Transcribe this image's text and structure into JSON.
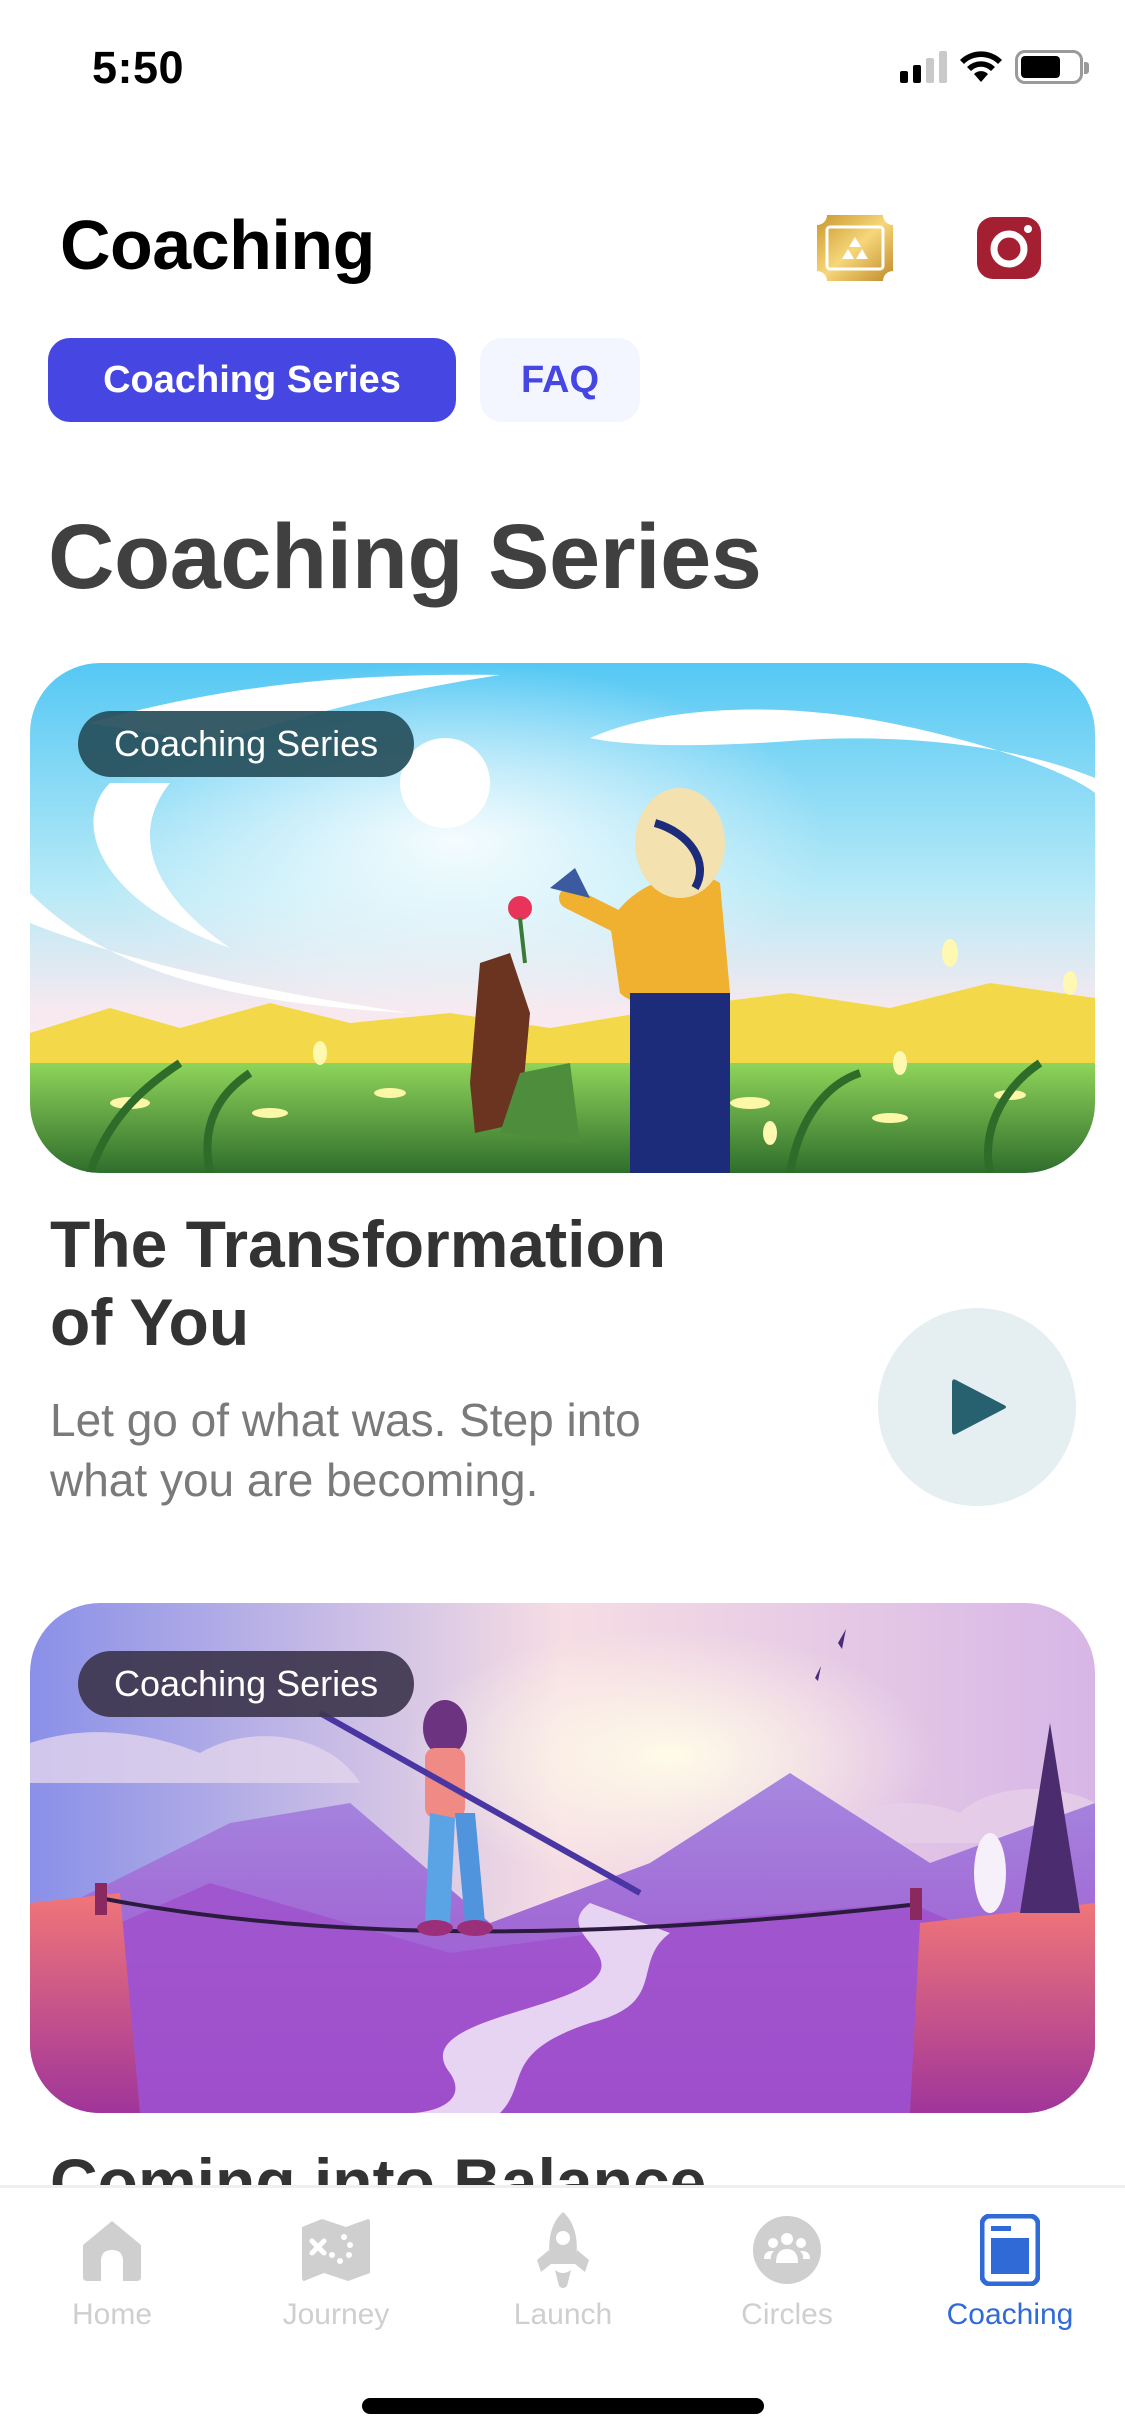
{
  "status_bar": {
    "time": "5:50",
    "signal_bars_active": 2,
    "signal_bars_total": 4,
    "battery_level": 0.7,
    "icons": [
      "signal-icon",
      "wifi-icon",
      "battery-icon"
    ]
  },
  "header": {
    "title": "Coaching",
    "icons": [
      "ticket-icon",
      "instagram-icon"
    ]
  },
  "tabs": [
    {
      "label": "Coaching Series",
      "active": true
    },
    {
      "label": "FAQ",
      "active": false
    }
  ],
  "section_title": "Coaching Series",
  "cards": [
    {
      "badge": "Coaching Series",
      "title_line1": "The Transformation",
      "title_line2": "of You",
      "description_line1": "Let go of what was. Step into",
      "description_line2": "what you are becoming.",
      "image": "illustration-person-watering-flower"
    },
    {
      "badge": "Coaching Series",
      "title": "Coming into Balance",
      "image": "illustration-tightrope-walker"
    }
  ],
  "tabbar": {
    "items": [
      {
        "label": "Home",
        "icon": "home-icon",
        "active": false
      },
      {
        "label": "Journey",
        "icon": "map-icon",
        "active": false
      },
      {
        "label": "Launch",
        "icon": "rocket-icon",
        "active": false
      },
      {
        "label": "Circles",
        "icon": "group-icon",
        "active": false
      },
      {
        "label": "Coaching",
        "icon": "book-icon",
        "active": true
      }
    ]
  },
  "colors": {
    "accent": "#4646e2",
    "tab_inactive_bg": "#f3f6fe",
    "active_tab_bar": "#2f6ad6",
    "inactive_tab_bar": "#cfcfcf",
    "play_icon": "#27606f",
    "play_bg": "#e5eef1",
    "instagram_red": "#a51f33",
    "ticket_gold": "#e2b94a"
  }
}
